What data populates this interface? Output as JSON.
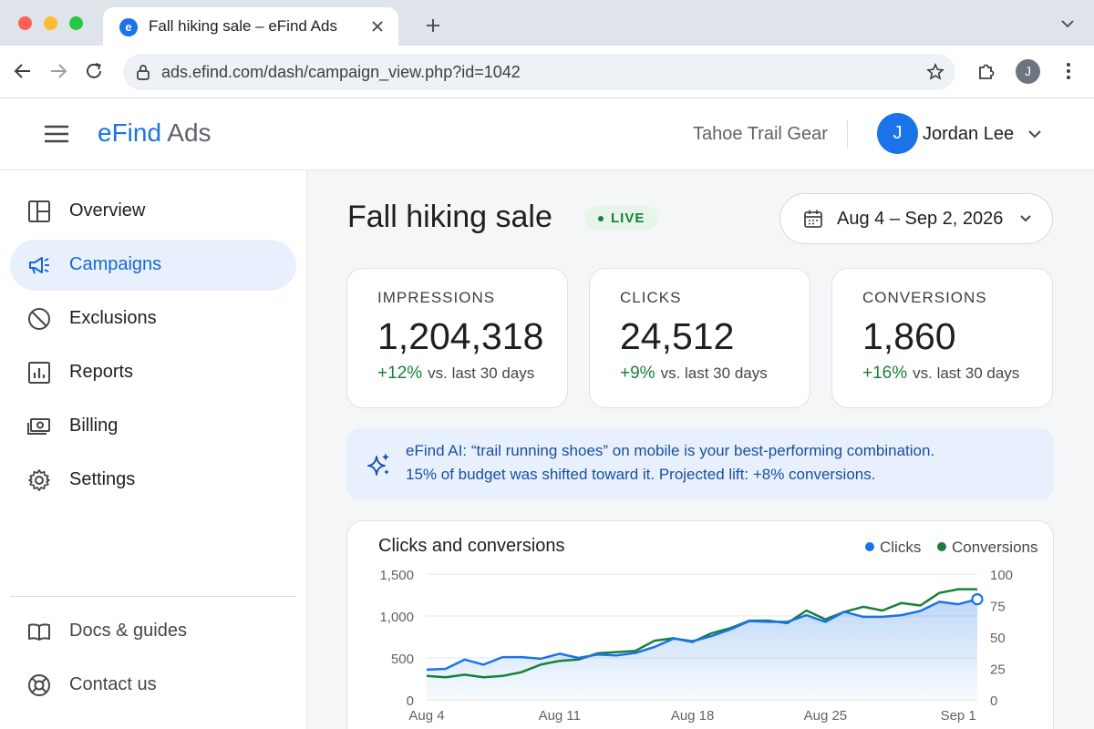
{
  "browser": {
    "tab_title": "Fall hiking sale – eFind Ads",
    "favicon_letter": "e",
    "url": "ads.efind.com/dash/campaign_view.php?id=1042",
    "profile_initial": "J"
  },
  "header": {
    "logo_main": "eFind",
    "logo_sub": "Ads",
    "account_name": "Tahoe Trail Gear",
    "user_initial": "J",
    "user_name": "Jordan Lee"
  },
  "sidebar": {
    "items": [
      {
        "label": "Overview",
        "icon": "layout-icon"
      },
      {
        "label": "Campaigns",
        "icon": "megaphone-icon",
        "active": true
      },
      {
        "label": "Exclusions",
        "icon": "block-icon"
      },
      {
        "label": "Reports",
        "icon": "report-icon"
      },
      {
        "label": "Billing",
        "icon": "money-icon"
      },
      {
        "label": "Settings",
        "icon": "gear-icon"
      }
    ],
    "footer": [
      {
        "label": "Docs & guides",
        "icon": "book-icon"
      },
      {
        "label": "Contact us",
        "icon": "lifebuoy-icon"
      }
    ]
  },
  "main": {
    "title": "Fall hiking sale",
    "status": "LIVE",
    "date_range": "Aug 4 – Sep 2, 2026",
    "kpis": [
      {
        "label": "IMPRESSIONS",
        "value": "1,204,318",
        "delta": "+12%",
        "note": "vs. last 30 days"
      },
      {
        "label": "CLICKS",
        "value": "24,512",
        "delta": "+9%",
        "note": "vs. last 30 days"
      },
      {
        "label": "CONVERSIONS",
        "value": "1,860",
        "delta": "+16%",
        "note": "vs. last 30 days"
      }
    ],
    "insight": {
      "line1": "eFind AI: “trail running shoes” on mobile is your best-performing combination.",
      "line2": "15% of budget was shifted toward it. Projected lift: +8% conversions."
    }
  },
  "colors": {
    "accent": "#1a73e8",
    "clicks": "#1a73e8",
    "conversions": "#188038",
    "live": "#188038"
  },
  "chart_data": {
    "type": "line",
    "title": "Clicks and conversions",
    "x": [
      "Aug 4",
      "Aug 5",
      "Aug 6",
      "Aug 7",
      "Aug 8",
      "Aug 9",
      "Aug 10",
      "Aug 11",
      "Aug 12",
      "Aug 13",
      "Aug 14",
      "Aug 15",
      "Aug 16",
      "Aug 17",
      "Aug 18",
      "Aug 19",
      "Aug 20",
      "Aug 21",
      "Aug 22",
      "Aug 23",
      "Aug 24",
      "Aug 25",
      "Aug 26",
      "Aug 27",
      "Aug 28",
      "Aug 29",
      "Aug 30",
      "Aug 31",
      "Sep 1",
      "Sep 2"
    ],
    "x_tick_labels": [
      "Aug 4",
      "Aug 11",
      "Aug 18",
      "Aug 25",
      "Sep 1"
    ],
    "x_tick_index": [
      0,
      7,
      14,
      21,
      28
    ],
    "series": [
      {
        "name": "Clicks",
        "axis": "left",
        "values": [
          360,
          370,
          480,
          420,
          510,
          510,
          490,
          550,
          500,
          540,
          530,
          560,
          630,
          730,
          700,
          760,
          840,
          940,
          930,
          930,
          1010,
          930,
          1050,
          990,
          990,
          1010,
          1060,
          1170,
          1140,
          1200
        ]
      },
      {
        "name": "Conversions",
        "axis": "right",
        "values": [
          19,
          18,
          20,
          18,
          19,
          22,
          28,
          31,
          32,
          37,
          38,
          39,
          47,
          49,
          46,
          53,
          57,
          63,
          63,
          61,
          71,
          64,
          70,
          74,
          71,
          77,
          75,
          85,
          88,
          88
        ]
      }
    ],
    "y_left": {
      "ticks": [
        0,
        500,
        1000,
        1500
      ],
      "tick_labels": [
        "0",
        "500",
        "1,000",
        "1,500"
      ],
      "range": [
        0,
        1500
      ]
    },
    "y_right": {
      "ticks": [
        0,
        25,
        50,
        75,
        100
      ],
      "range": [
        0,
        100
      ]
    },
    "area_fill_series": "Clicks",
    "legend": "top-right",
    "grid": true
  }
}
